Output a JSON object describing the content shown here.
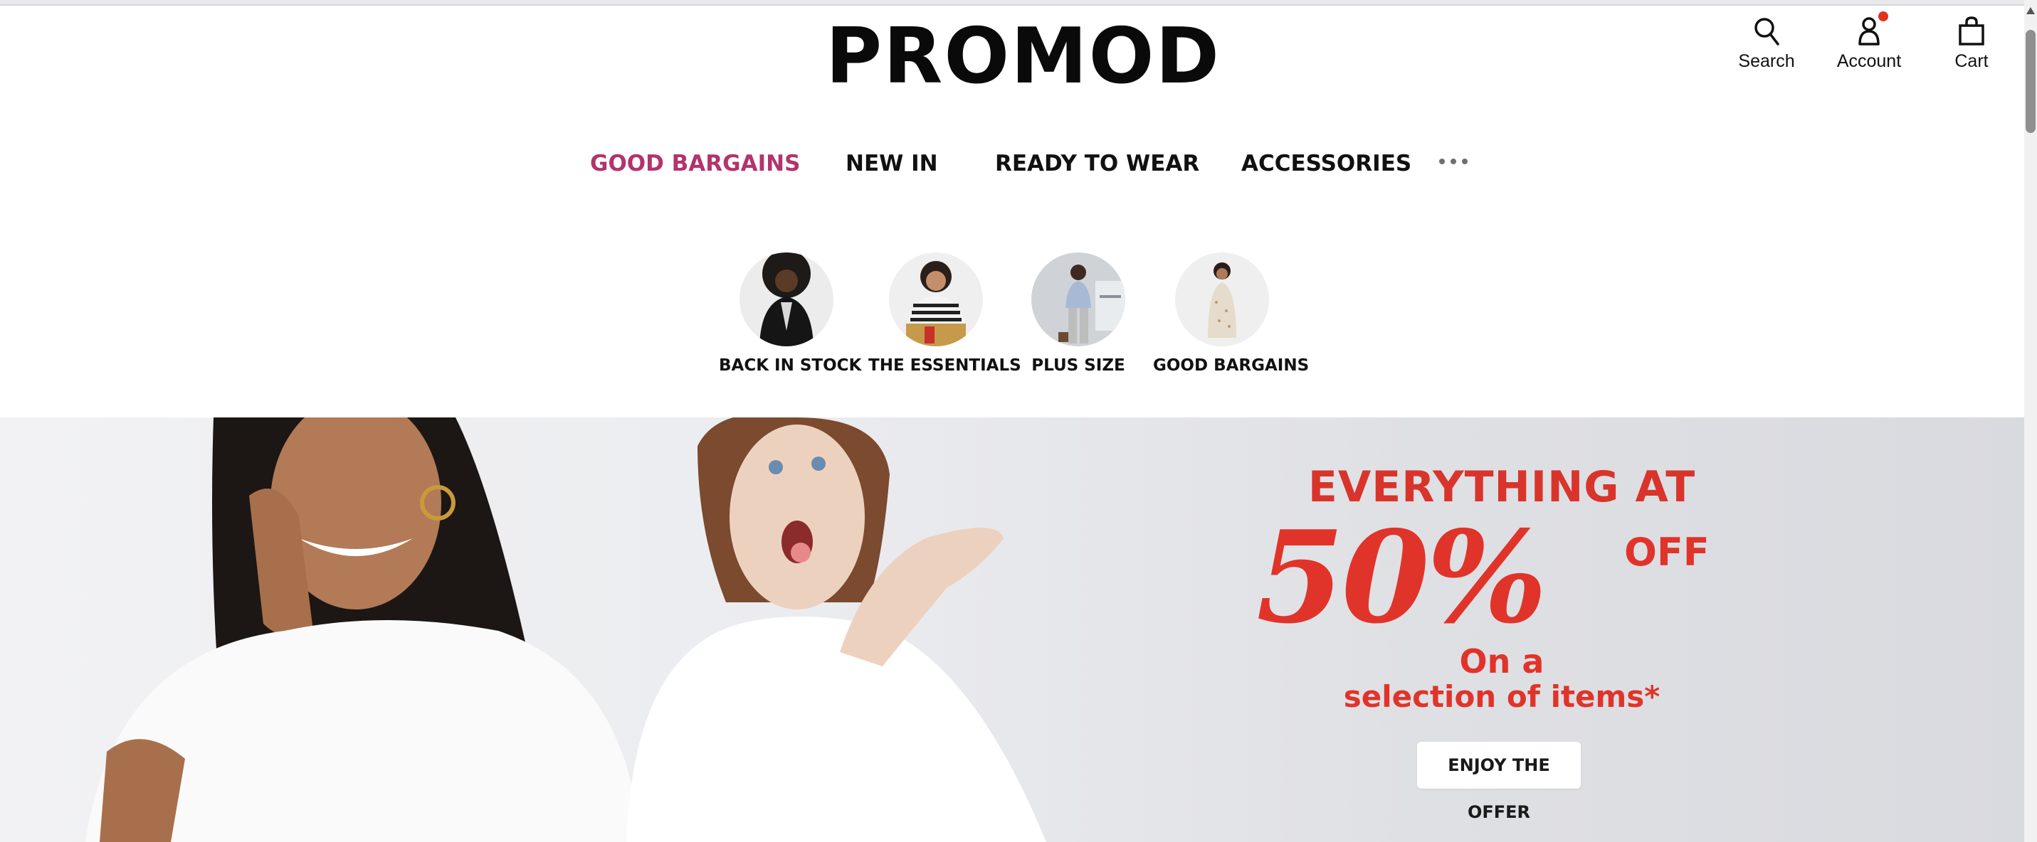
{
  "brand": {
    "logo": "PROMOD"
  },
  "utility": {
    "search_label": "Search",
    "account_label": "Account",
    "cart_label": "Cart",
    "account_badge_color": "#e0331f"
  },
  "nav": {
    "items": [
      {
        "label": "GOOD BARGAINS",
        "active": true
      },
      {
        "label": "NEW IN",
        "active": false
      },
      {
        "label": "READY TO WEAR",
        "active": false
      },
      {
        "label": "ACCESSORIES",
        "active": false
      }
    ],
    "more_icon": "more-dots-icon",
    "active_color": "#b3336d"
  },
  "categories": [
    {
      "label": "BACK IN STOCK"
    },
    {
      "label": "THE ESSENTIALS"
    },
    {
      "label": "PLUS SIZE"
    },
    {
      "label": "GOOD BARGAINS"
    }
  ],
  "hero": {
    "headline": "EVERYTHING AT",
    "percent": "50%",
    "off": "OFF",
    "sub_line1": "On a",
    "sub_line2": "selection of items*",
    "cta_label": "ENJOY THE OFFER",
    "accent_color": "#e0342a"
  }
}
